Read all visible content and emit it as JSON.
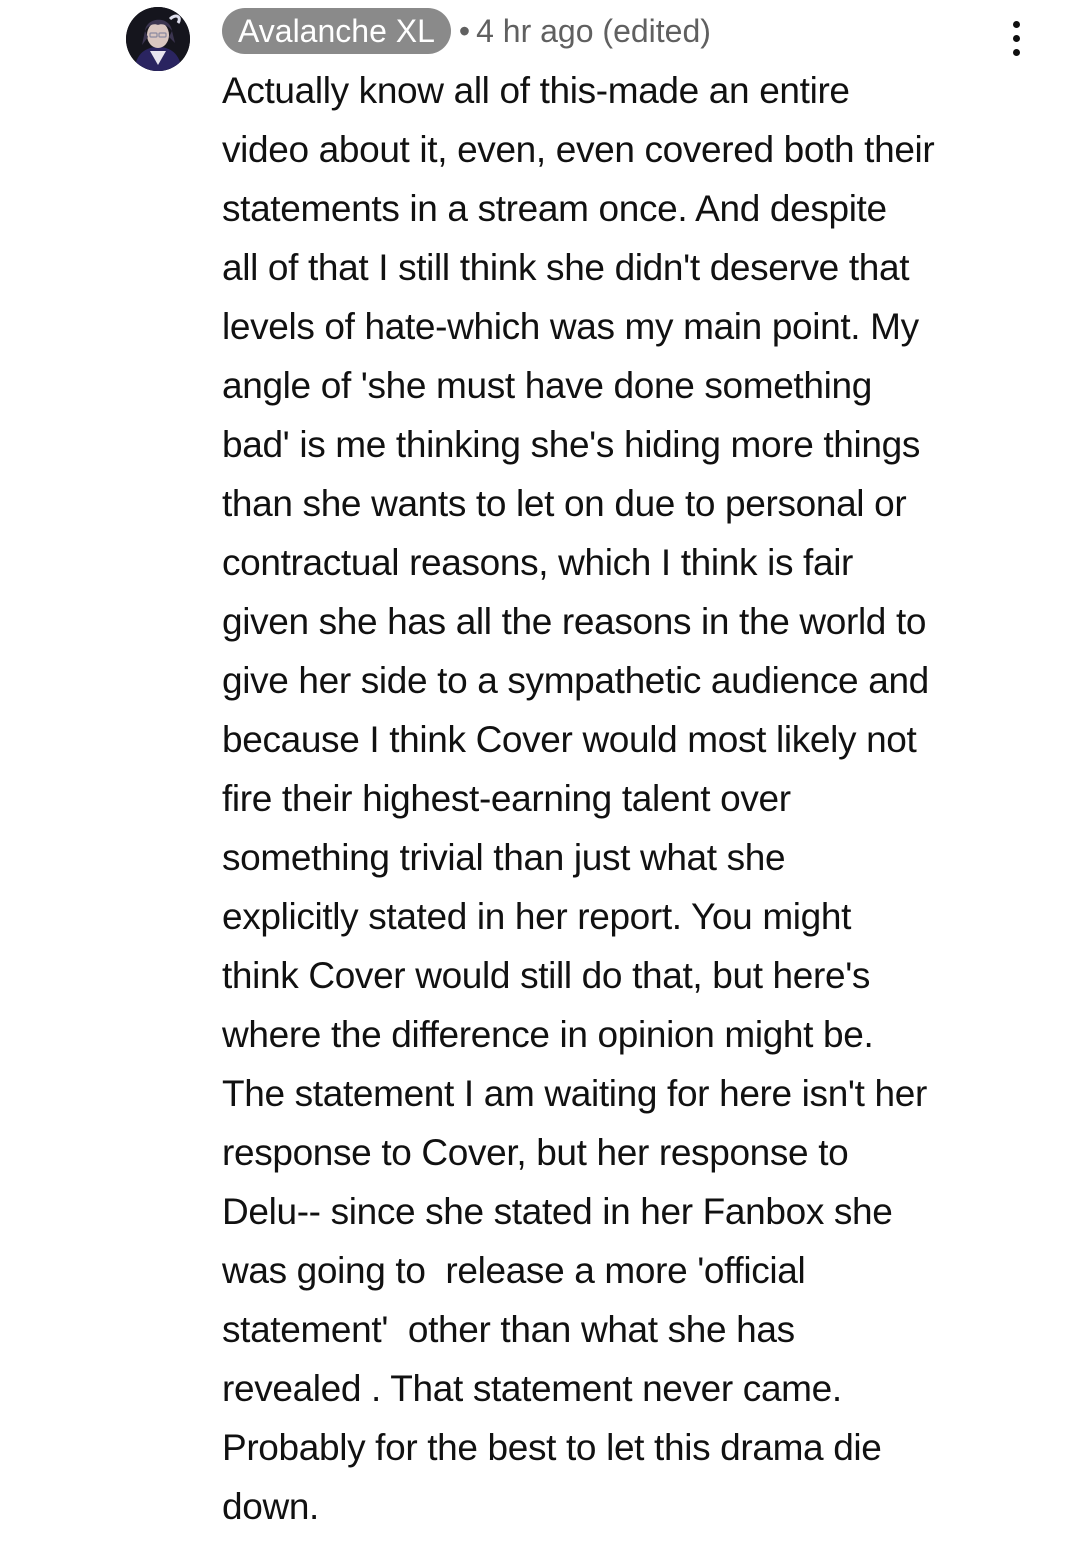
{
  "comment": {
    "author": "Avalanche XL",
    "meta_separator": "•",
    "timestamp": "4 hr ago (edited)",
    "more_icon": "vertical-ellipsis-icon",
    "avatar_icon": "user-avatar",
    "body_lines": [
      "Actually know all of this-made an entire",
      "video about it, even, even covered both their",
      "statements in a stream once. And despite",
      "all of that I still think she didn't deserve that",
      "levels of hate-which was my main point. My",
      "angle of 'she must have done something",
      "bad' is me thinking she's hiding more things",
      "than she wants to let on due to personal or",
      "contractual reasons, which I think is fair",
      "given she has all the reasons in the world to",
      "give her side to a sympathetic audience and",
      "because I think Cover would most likely not",
      "fire their highest-earning talent over",
      "something trivial than just what she",
      "explicitly stated in her report. You might",
      "think Cover would still do that, but here's",
      "where the difference in opinion might be.",
      "The statement I am waiting for here isn't her",
      "response to Cover, but her response to",
      "Delu-- since she stated in her Fanbox she",
      "was going to  release a more 'official",
      "statement'  other than what she has",
      "revealed . That statement never came.",
      "Probably for the best to let this drama die",
      "down."
    ]
  }
}
